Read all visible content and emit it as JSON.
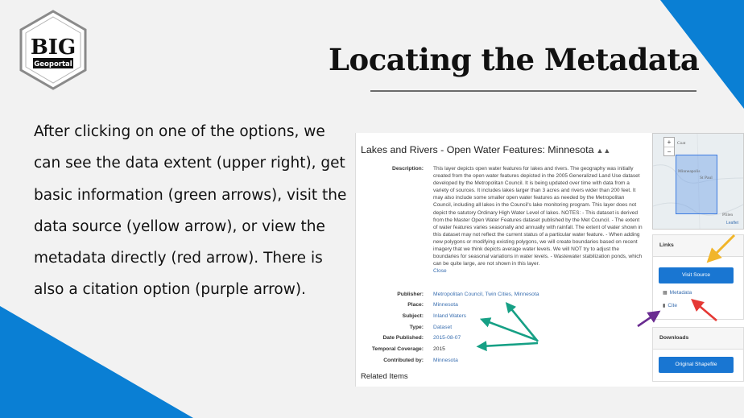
{
  "logo": {
    "wordmark": "BIG",
    "subtitle": "Geoportal"
  },
  "slide": {
    "title": "Locating the Metadata",
    "body": "After clicking on one of the options, we can see the data extent (upper right), get basic information (green arrows), visit the data source (yellow arrow), or view the metadata directly (red arrow). There is also a citation option (purple arrow)."
  },
  "colors": {
    "accent_blue": "#0a7fd4",
    "arrow_yellow": "#f1b52a",
    "arrow_green": "#16a085",
    "arrow_red": "#e53935",
    "arrow_purple": "#6a2c91",
    "button_blue": "#1976d2"
  },
  "screenshot": {
    "page_title": "Lakes and Rivers - Open Water Features: Minnesota",
    "title_icon": "map-icon",
    "description_label": "Description:",
    "description": "This layer depicts open water features for lakes and rivers. The geography was initially created from the open water features depicted in the 2005 Generalized Land Use dataset developed by the Metropolitan Council. It is being updated over time with data from a variety of sources. It includes lakes larger than 3 acres and rivers wider than 200 feet. It may also include some smaller open water features as needed by the Metropolitan Council, including all lakes in the Council's lake monitoring program. This layer does not depict the satutory Ordinary High Water Level of lakes. NOTES: - This dataset is derived from the Master Open Water Features dataset published by the Met Council. - The extent of water features varies seasonally and annually with rainfall. The extent of water shown in this dataset may not reflect the current status of a particular water feature. - When adding new polygons or modifying existing polygons, we will create boundaries based on recent imagery that we think depicts average water levels. We will NOT try to adjust the boundaries for seasonal variations in water levels. - Wastewater stabilization ponds, which can be quite large, are not shown in this layer.",
    "close_link": "Close",
    "fields": [
      {
        "label": "Publisher:",
        "value": "Metropolitan Council, Twin Cities, Minnesota",
        "link": true
      },
      {
        "label": "Place:",
        "value": "Minnesota",
        "link": true
      },
      {
        "label": "Subject:",
        "value": "Inland Waters",
        "link": true
      },
      {
        "label": "Type:",
        "value": "Dataset",
        "link": true
      },
      {
        "label": "Date Published:",
        "value": "2015-08-07",
        "link": true
      },
      {
        "label": "Temporal Coverage:",
        "value": "2015",
        "link": false
      },
      {
        "label": "Contributed by:",
        "value": "Minnesota",
        "link": true
      }
    ],
    "related_items": "Related Items",
    "map": {
      "zoom_in": "+",
      "zoom_out": "−",
      "label_lake": "Coat",
      "label_city": "Minneapolis",
      "label_stpaul": "St Paul",
      "label_south": "Pfilen",
      "attribution": "Leaflet"
    },
    "links_panel": {
      "heading": "Links",
      "visit_source": "Visit Source",
      "metadata": "Metadata",
      "cite": "Cite",
      "metadata_icon": "document-icon",
      "cite_icon": "bookmark-icon"
    },
    "downloads_panel": {
      "heading": "Downloads",
      "original_shapefile": "Original Shapefile"
    }
  }
}
